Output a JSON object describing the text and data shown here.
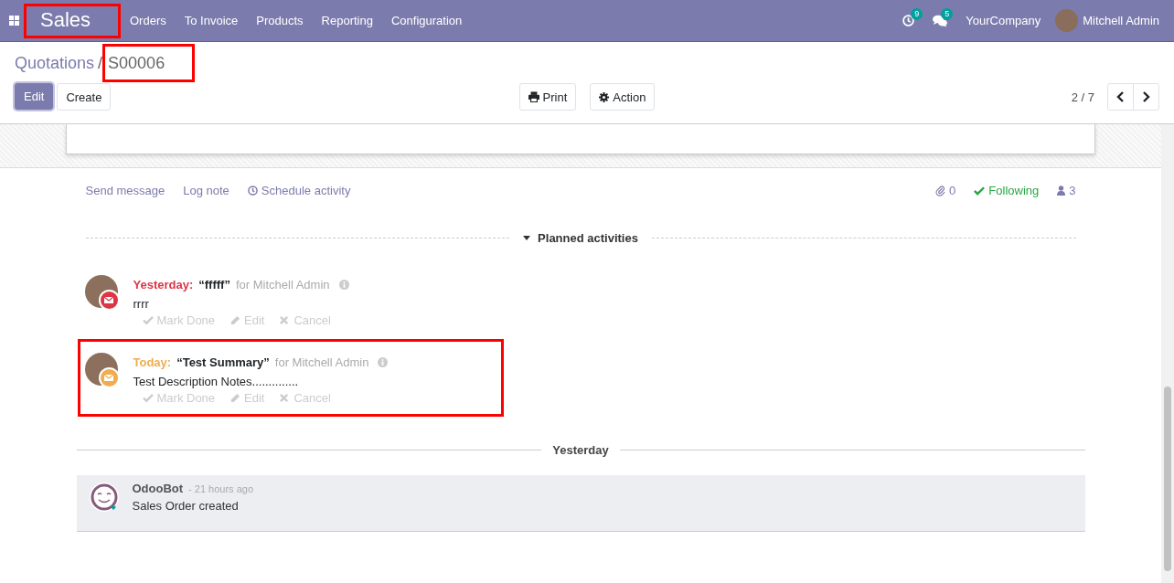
{
  "navbar": {
    "brand": "Sales",
    "brand_highlighted": true,
    "menu": [
      "Orders",
      "To Invoice",
      "Products",
      "Reporting",
      "Configuration"
    ],
    "activity_count": "9",
    "message_count": "5",
    "company": "YourCompany",
    "user": "Mitchell Admin"
  },
  "breadcrumb": {
    "parent": "Quotations",
    "separator": "/",
    "current": "S00006",
    "current_highlighted": true
  },
  "buttons": {
    "edit": "Edit",
    "create": "Create",
    "print": "Print",
    "action": "Action"
  },
  "pager": {
    "value": "2 / 7"
  },
  "chatter": {
    "actions": [
      {
        "kind": "message",
        "label": "Send message"
      },
      {
        "kind": "note",
        "label": "Log note"
      },
      {
        "kind": "activity",
        "label": "Schedule activity"
      }
    ],
    "attachments": "0",
    "follow": "Following",
    "followers": "3"
  },
  "planned": {
    "title": "Planned activities",
    "expanded": true,
    "activities": [
      {
        "due": "Yesterday:",
        "color": "#dc3545",
        "summary": "“fffff”",
        "assignee": "for Mitchell Admin",
        "note": "rrrr",
        "buttons": [
          "Mark Done",
          "Edit",
          "Cancel"
        ],
        "highlighted": false
      },
      {
        "due": "Today:",
        "color": "#f0ad4e",
        "summary": "“Test Summary”",
        "assignee": "for Mitchell Admin",
        "note": "Test Description Notes..............",
        "buttons": [
          "Mark Done",
          "Edit",
          "Cancel"
        ],
        "highlighted": true
      }
    ]
  },
  "date_separator": "Yesterday",
  "messages": [
    {
      "author": "OdooBot",
      "time": "- 21 hours ago",
      "body": "Sales Order created"
    }
  ]
}
